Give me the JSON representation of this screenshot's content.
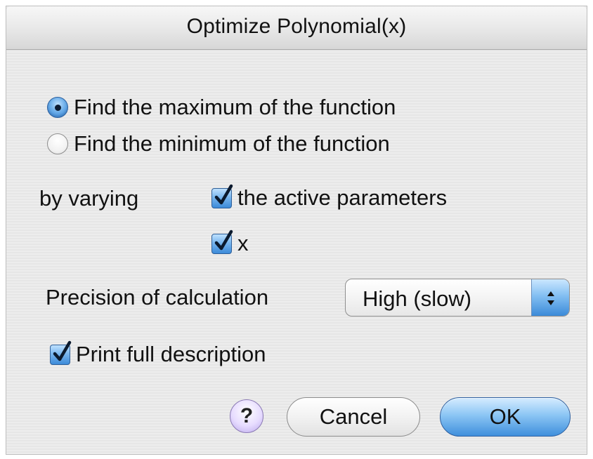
{
  "dialog": {
    "title": "Optimize Polynomial(x)"
  },
  "objective": {
    "options": [
      {
        "label": "Find the maximum of the function",
        "selected": true
      },
      {
        "label": "Find the minimum of the function",
        "selected": false
      }
    ]
  },
  "varying": {
    "label": "by varying",
    "options": [
      {
        "label": "the active parameters",
        "checked": true
      },
      {
        "label": "x",
        "checked": true
      }
    ]
  },
  "precision": {
    "label": "Precision of calculation",
    "value": "High (slow)"
  },
  "print_description": {
    "label": "Print full description",
    "checked": true
  },
  "buttons": {
    "help": "?",
    "cancel": "Cancel",
    "ok": "OK"
  },
  "colors": {
    "accent": "#3b8ad8",
    "window_bg": "#ececec"
  },
  "icons": [
    "radio-selected-icon",
    "radio-unselected-icon",
    "checkmark-icon",
    "popup-arrows-icon",
    "help-icon"
  ]
}
